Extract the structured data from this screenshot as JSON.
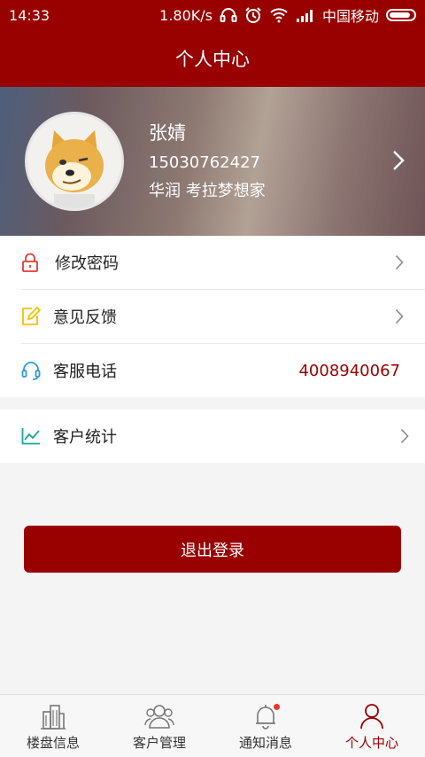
{
  "status_bar": {
    "time": "14:33",
    "speed": "1.80K/s",
    "carrier": "中国移动",
    "icons": [
      "headset-icon",
      "alarm-icon",
      "wifi-icon",
      "signal-icon",
      "battery-icon"
    ]
  },
  "header": {
    "title": "个人中心"
  },
  "profile": {
    "name": "张婧",
    "phone": "15030762427",
    "company": "华润 考拉梦想家"
  },
  "menu": {
    "change_password": "修改密码",
    "feedback": "意见反馈",
    "service_phone": "客服电话",
    "service_phone_number": "4008940067",
    "customer_stats": "客户统计"
  },
  "logout_label": "退出登录",
  "tabs": [
    {
      "label": "楼盘信息",
      "icon": "building-icon"
    },
    {
      "label": "客户管理",
      "icon": "users-icon"
    },
    {
      "label": "通知消息",
      "icon": "bell-icon"
    },
    {
      "label": "个人中心",
      "icon": "person-icon"
    }
  ],
  "active_tab": "个人中心",
  "colors": {
    "brand": "#990000",
    "accent_red": "#e53935",
    "icon_yellow": "#f2c200",
    "icon_blue": "#2d9bd8",
    "icon_teal": "#1aa59a"
  }
}
